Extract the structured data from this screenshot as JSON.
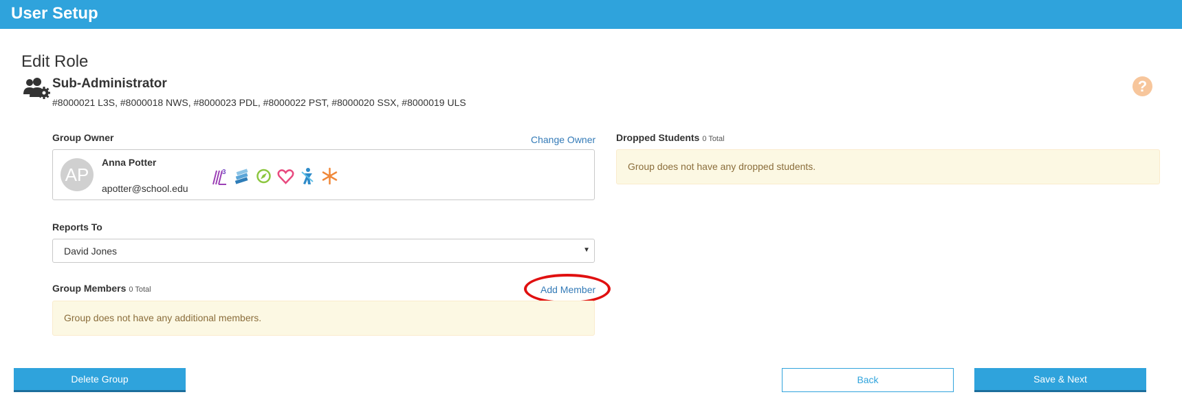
{
  "header": {
    "title": "User Setup"
  },
  "page": {
    "heading": "Edit Role"
  },
  "role": {
    "name": "Sub-Administrator",
    "codes": "#8000021 L3S, #8000018 NWS, #8000023 PDL, #8000022 PST, #8000020 SSX, #8000019 ULS",
    "icon": "users-gear-icon"
  },
  "help": {
    "icon": "help-icon",
    "glyph": "?"
  },
  "group_owner": {
    "label": "Group Owner",
    "change_link": "Change Owner",
    "initials": "AP",
    "name": "Anna Potter",
    "email": "apotter@school.edu",
    "app_icons": [
      "l3-icon",
      "books-icon",
      "compass-icon",
      "heart-icon",
      "figure-icon",
      "snowflake-icon"
    ]
  },
  "reports_to": {
    "label": "Reports To",
    "value": "David Jones"
  },
  "group_members": {
    "label": "Group Members",
    "count": "0 Total",
    "add_link": "Add Member",
    "empty_message": "Group does not have any additional members."
  },
  "dropped_students": {
    "label": "Dropped Students",
    "count": "0 Total",
    "empty_message": "Group does not have any dropped students."
  },
  "buttons": {
    "delete": "Delete Group",
    "back": "Back",
    "save_next": "Save & Next"
  },
  "colors": {
    "accent": "#2fa3dc",
    "link": "#337ab7",
    "notice_bg": "#fcf8e3",
    "notice_text": "#8a6d3b",
    "highlight": "#e01010",
    "help": "#f7c69c"
  }
}
